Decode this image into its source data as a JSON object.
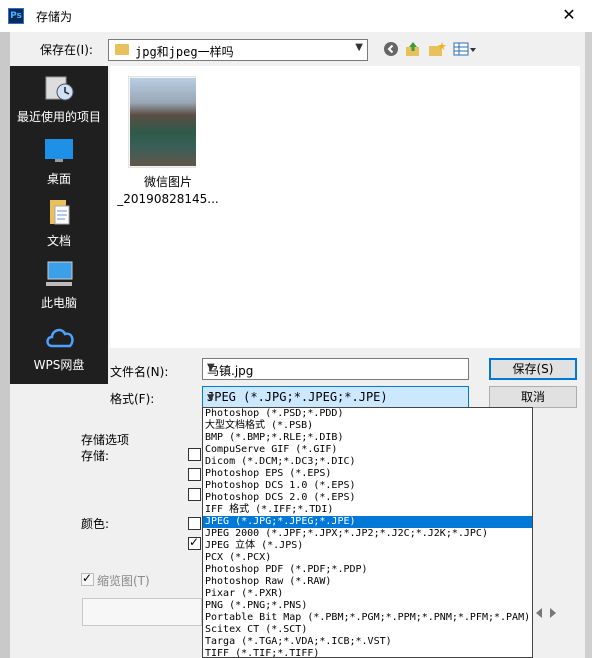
{
  "window": {
    "title": "存储为",
    "app_icon": "Ps",
    "close": "✕"
  },
  "header": {
    "save_in_label": "保存在(I):",
    "path": "jpg和jpeg一样吗",
    "icons": [
      "back-icon",
      "up-folder-icon",
      "new-folder-icon",
      "view-menu-icon"
    ]
  },
  "places": [
    {
      "name": "recent",
      "label": "最近使用的项目"
    },
    {
      "name": "desktop",
      "label": "桌面"
    },
    {
      "name": "documents",
      "label": "文档"
    },
    {
      "name": "this-pc",
      "label": "此电脑"
    },
    {
      "name": "wps",
      "label": "WPS网盘"
    }
  ],
  "files": [
    {
      "label_line1": "微信图片",
      "label_line2": "_20190828145..."
    }
  ],
  "form": {
    "filename_label": "文件名(N):",
    "filename_value": "乌镇.jpg",
    "format_label": "格式(F):",
    "format_value": "JPEG (*.JPG;*.JPEG;*.JPE)",
    "save_button": "保存(S)",
    "cancel_button": "取消"
  },
  "options": {
    "section_title": "存储选项",
    "save_label": "存储:",
    "color_label": "颜色:",
    "thumbnail_label": "缩览图(T)"
  },
  "format_options": [
    "Photoshop (*.PSD;*.PDD)",
    "大型文档格式 (*.PSB)",
    "BMP (*.BMP;*.RLE;*.DIB)",
    "CompuServe GIF (*.GIF)",
    "Dicom (*.DCM;*.DC3;*.DIC)",
    "Photoshop EPS (*.EPS)",
    "Photoshop DCS 1.0 (*.EPS)",
    "Photoshop DCS 2.0 (*.EPS)",
    "IFF 格式 (*.IFF;*.TDI)",
    "JPEG (*.JPG;*.JPEG;*.JPE)",
    "JPEG 2000 (*.JPF;*.JPX;*.JP2;*.J2C;*.J2K;*.JPC)",
    "JPEG 立体 (*.JPS)",
    "PCX (*.PCX)",
    "Photoshop PDF (*.PDF;*.PDP)",
    "Photoshop Raw (*.RAW)",
    "Pixar (*.PXR)",
    "PNG (*.PNG;*.PNS)",
    "Portable Bit Map (*.PBM;*.PGM;*.PPM;*.PNM;*.PFM;*.PAM)",
    "Scitex CT (*.SCT)",
    "Targa (*.TGA;*.VDA;*.ICB;*.VST)",
    "TIFF (*.TIF;*.TIFF)"
  ],
  "selected_format_index": 9,
  "colors": {
    "accent": "#0078d7",
    "places_bg": "#1f1f1f"
  }
}
